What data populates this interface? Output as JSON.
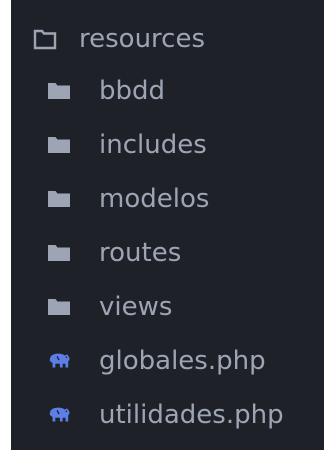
{
  "explorer": {
    "root": {
      "label": "resources",
      "icon": "folder-outline-icon"
    },
    "items": [
      {
        "label": "bbdd",
        "icon": "folder-icon"
      },
      {
        "label": "includes",
        "icon": "folder-icon"
      },
      {
        "label": "modelos",
        "icon": "folder-icon"
      },
      {
        "label": "routes",
        "icon": "folder-icon"
      },
      {
        "label": "views",
        "icon": "folder-icon"
      },
      {
        "label": "globales.php",
        "icon": "php-elephant-icon"
      },
      {
        "label": "utilidades.php",
        "icon": "php-elephant-icon"
      }
    ]
  },
  "colors": {
    "panel_background": "#1e2127",
    "text": "#9da5b4",
    "folder_icon": "#9da5b4",
    "php_icon": "#5c7ee6"
  }
}
